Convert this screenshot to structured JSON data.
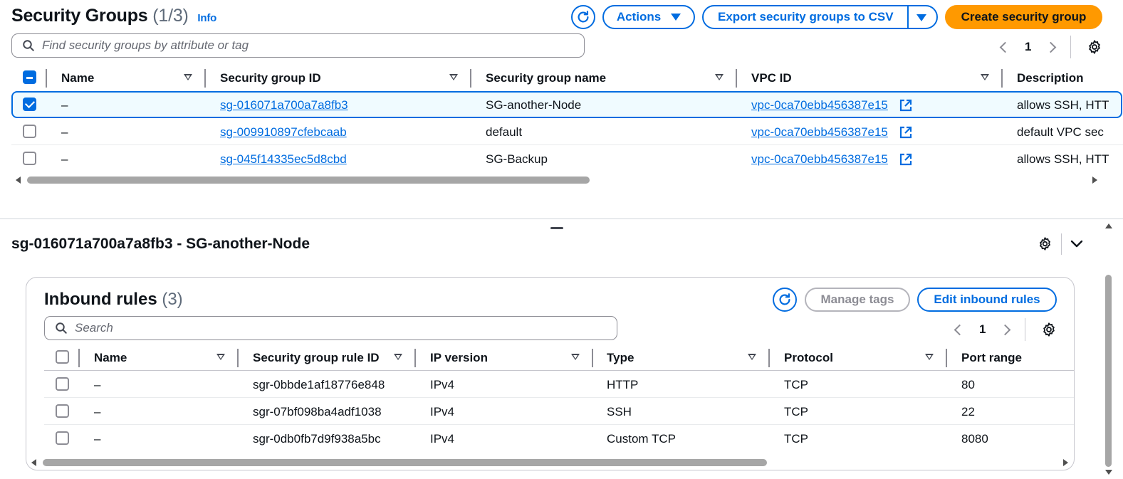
{
  "header": {
    "title": "Security Groups",
    "count": "(1/3)",
    "info_link": "Info",
    "actions_label": "Actions",
    "export_label": "Export security groups to CSV",
    "create_label": "Create security group"
  },
  "search": {
    "placeholder": "Find security groups by attribute or tag"
  },
  "pagination": {
    "page": "1"
  },
  "groups_table": {
    "columns": [
      "Name",
      "Security group ID",
      "Security group name",
      "VPC ID",
      "Description"
    ],
    "rows": [
      {
        "selected": true,
        "name": "–",
        "sg_id": "sg-016071a700a7a8fb3",
        "sg_name": "SG-another-Node",
        "vpc_id": "vpc-0ca70ebb456387e15",
        "description": "allows SSH, HTT"
      },
      {
        "selected": false,
        "name": "–",
        "sg_id": "sg-009910897cfebcaab",
        "sg_name": "default",
        "vpc_id": "vpc-0ca70ebb456387e15",
        "description": "default VPC sec"
      },
      {
        "selected": false,
        "name": "–",
        "sg_id": "sg-045f14335ec5d8cbd",
        "sg_name": "SG-Backup",
        "vpc_id": "vpc-0ca70ebb456387e15",
        "description": "allows SSH, HTT"
      }
    ]
  },
  "detail": {
    "title": "sg-016071a700a7a8fb3 - SG-another-Node"
  },
  "inbound": {
    "title": "Inbound rules",
    "count": "(3)",
    "manage_tags_label": "Manage tags",
    "edit_label": "Edit inbound rules",
    "search_placeholder": "Search",
    "page": "1",
    "columns": [
      "Name",
      "Security group rule ID",
      "IP version",
      "Type",
      "Protocol",
      "Port range"
    ],
    "rows": [
      {
        "name": "–",
        "rule_id": "sgr-0bbde1af18776e848",
        "ip_version": "IPv4",
        "type": "HTTP",
        "protocol": "TCP",
        "port_range": "80"
      },
      {
        "name": "–",
        "rule_id": "sgr-07bf098ba4adf1038",
        "ip_version": "IPv4",
        "type": "SSH",
        "protocol": "TCP",
        "port_range": "22"
      },
      {
        "name": "–",
        "rule_id": "sgr-0db0fb7d9f938a5bc",
        "ip_version": "IPv4",
        "type": "Custom TCP",
        "protocol": "TCP",
        "port_range": "8080"
      }
    ]
  },
  "colors": {
    "accent": "#006ce0",
    "primary_button": "#ff9900",
    "selected_row_bg": "#f0fbff"
  },
  "icons": [
    "search-icon",
    "refresh-icon",
    "settings-icon",
    "external-link-icon",
    "chevron-down-icon",
    "chevron-left-icon",
    "chevron-right-icon",
    "drag-handle-icon"
  ]
}
